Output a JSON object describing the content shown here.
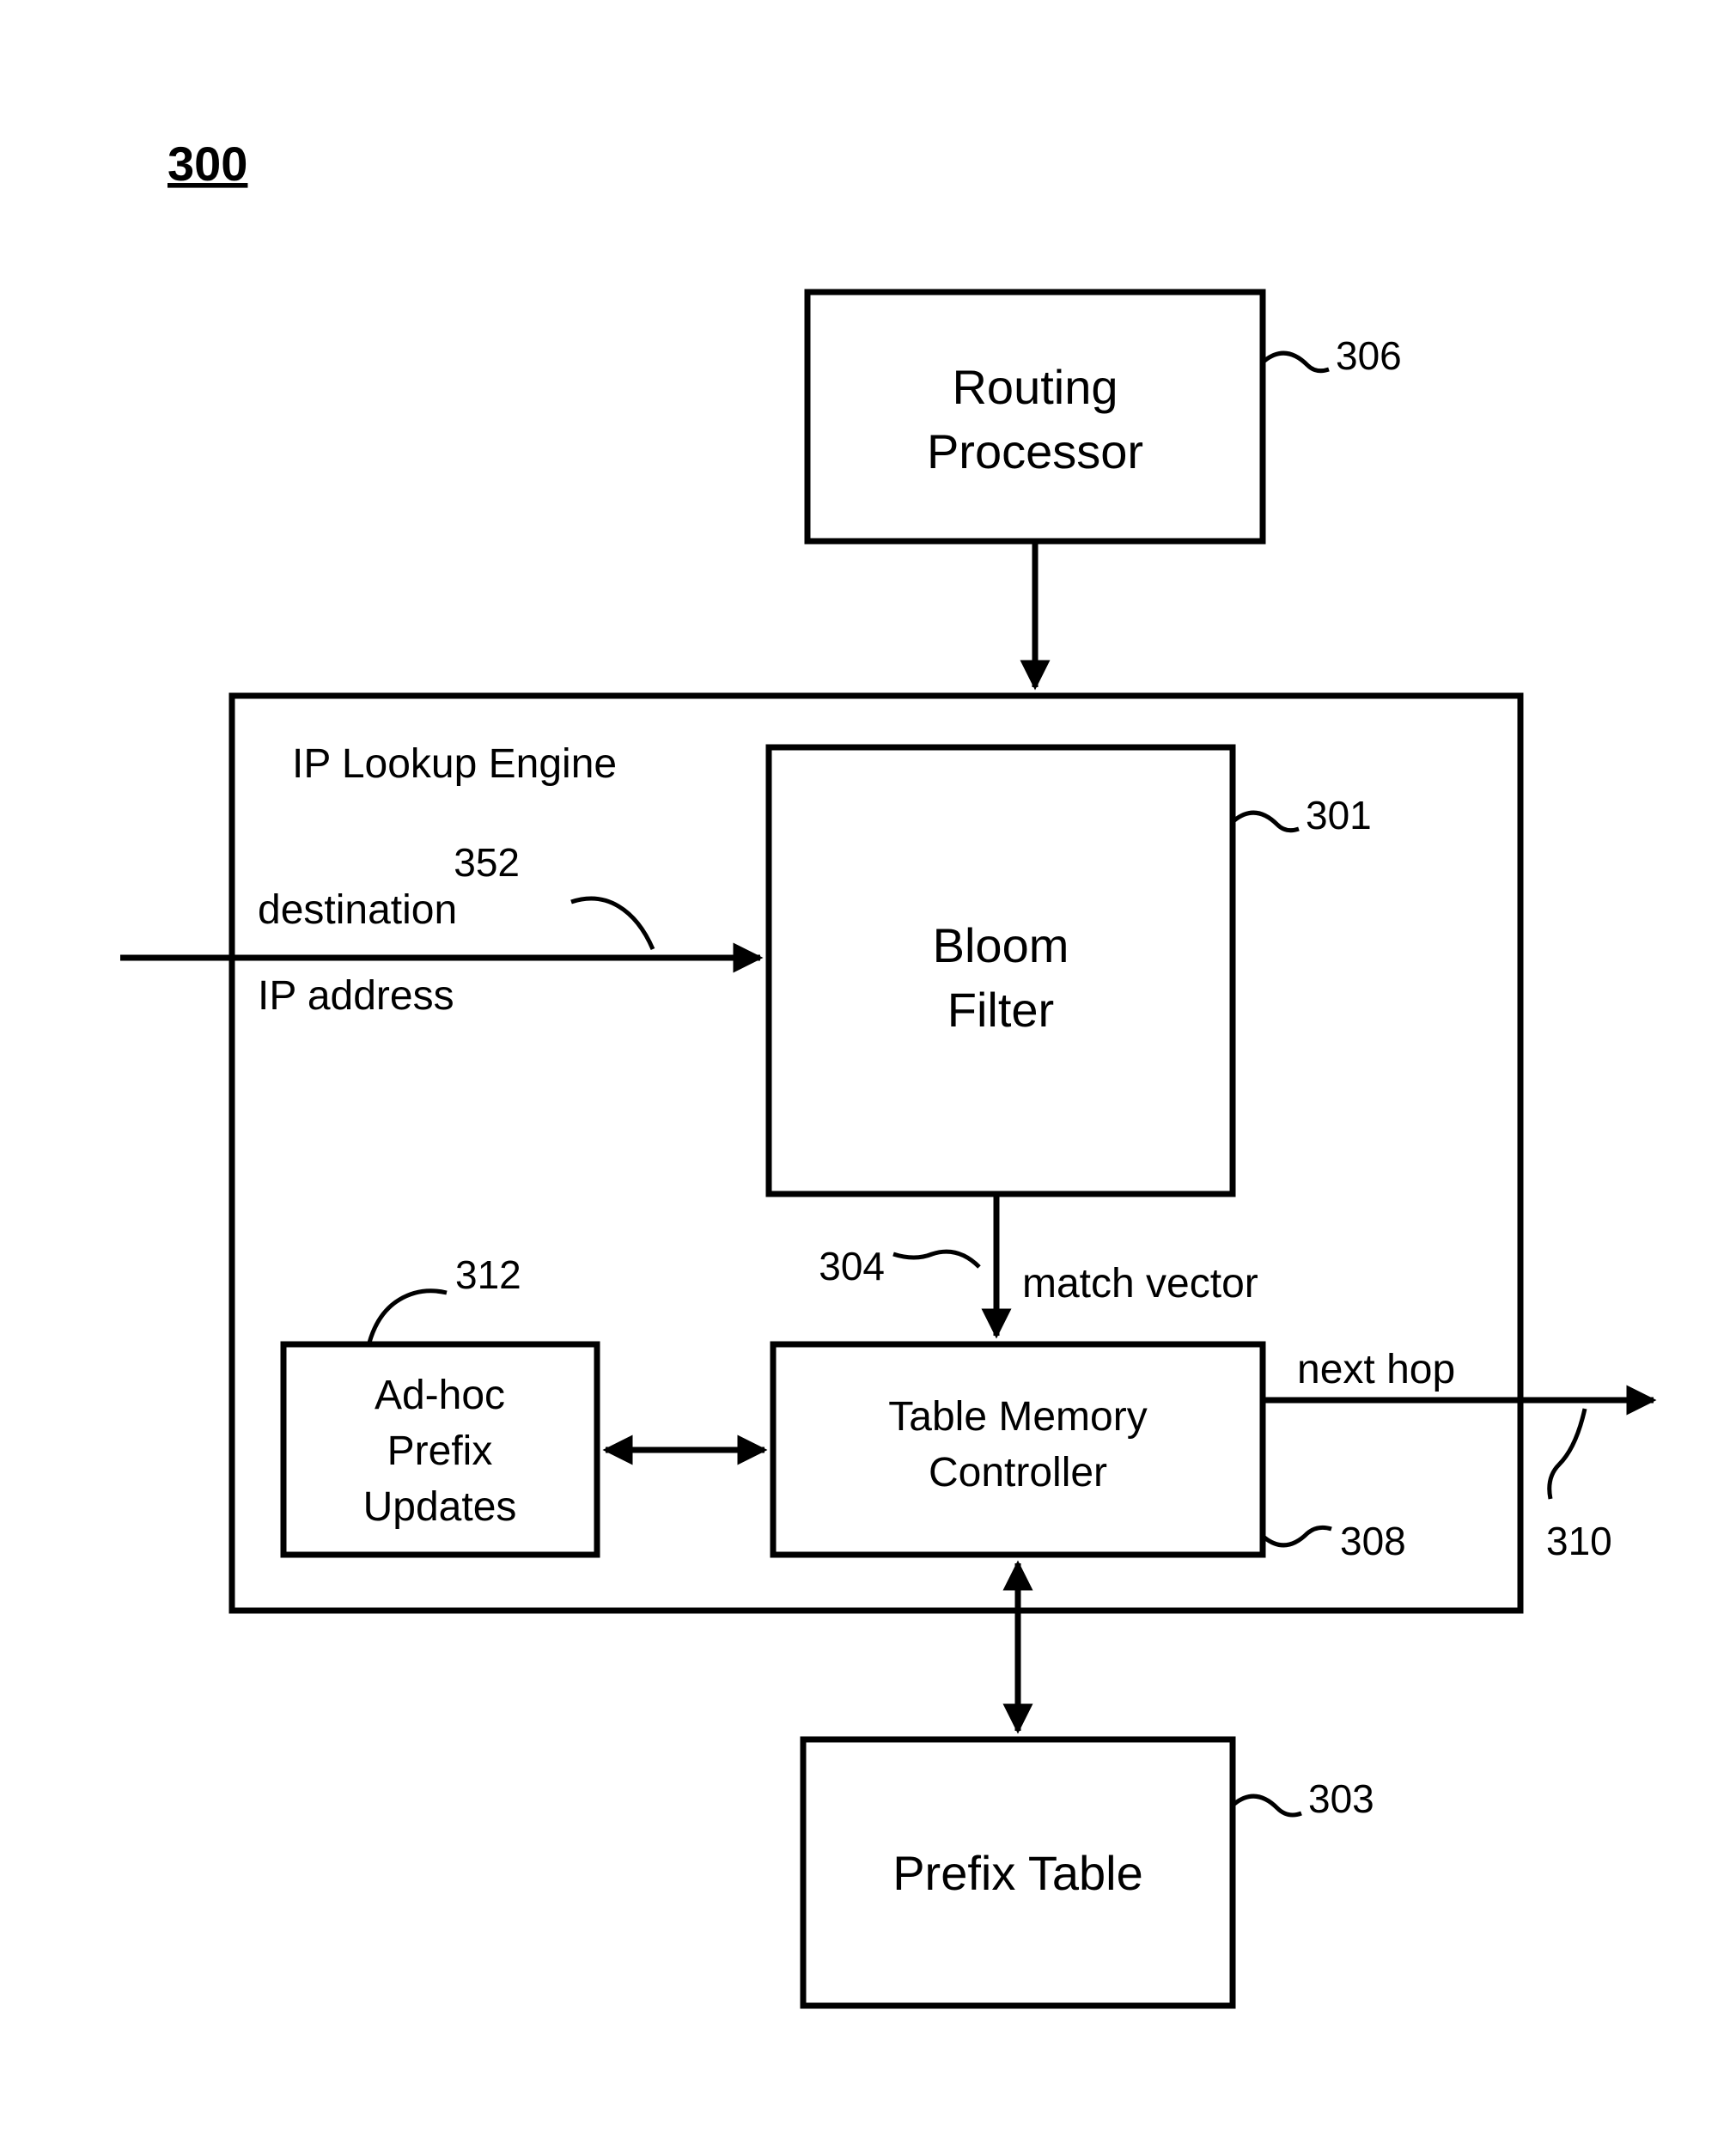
{
  "figure_number": "300",
  "blocks": {
    "routing_processor": {
      "line1": "Routing",
      "line2": "Processor",
      "ref": "306"
    },
    "ip_lookup_engine": {
      "title": "IP Lookup Engine"
    },
    "bloom_filter": {
      "line1": "Bloom",
      "line2": "Filter",
      "ref": "301"
    },
    "adhoc": {
      "line1": "Ad-hoc",
      "line2": "Prefix",
      "line3": "Updates",
      "ref": "312"
    },
    "tmc": {
      "line1": "Table Memory",
      "line2": "Controller",
      "ref": "308"
    },
    "prefix_table": {
      "line1": "Prefix Table",
      "ref": "303"
    }
  },
  "signals": {
    "dest_ip": {
      "line1": "destination",
      "line2": "IP address",
      "ref": "352"
    },
    "match_vector": {
      "label": "match vector",
      "ref": "304"
    },
    "next_hop": {
      "label": "next hop",
      "ref": "310"
    }
  }
}
